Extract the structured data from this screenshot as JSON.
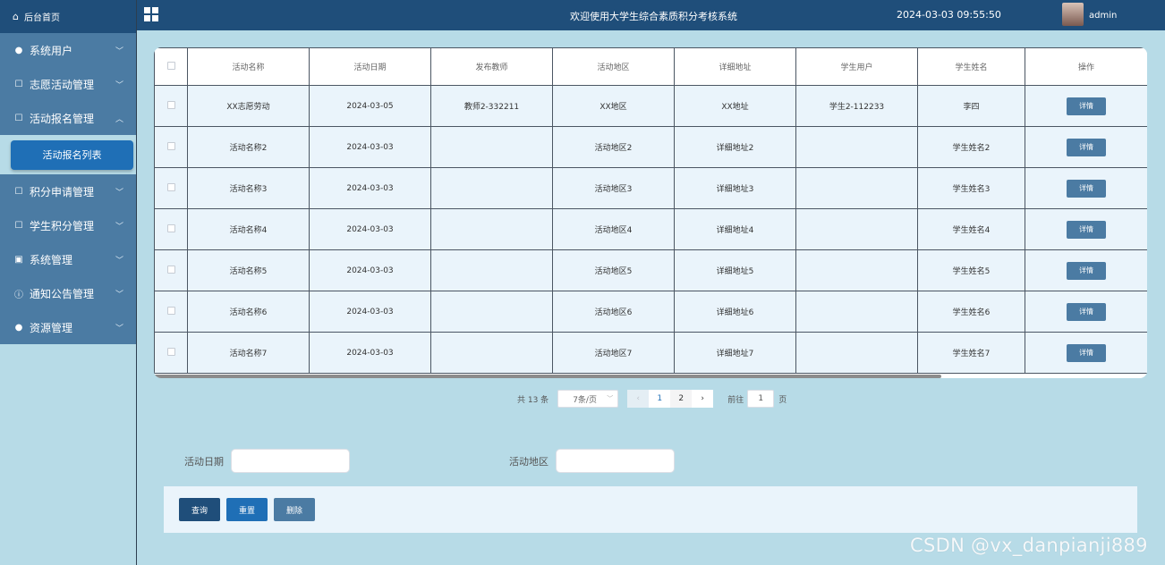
{
  "sidebar": {
    "home_label": "后台首页",
    "items": [
      {
        "label": "系统用户",
        "icon": "user-icon"
      },
      {
        "label": "志愿活动管理",
        "icon": "edit-icon"
      },
      {
        "label": "活动报名管理",
        "icon": "edit-icon"
      },
      {
        "label": "积分申请管理",
        "icon": "edit-icon"
      },
      {
        "label": "学生积分管理",
        "icon": "edit-icon"
      },
      {
        "label": "系统管理",
        "icon": "picture-icon"
      },
      {
        "label": "通知公告管理",
        "icon": "info-icon"
      },
      {
        "label": "资源管理",
        "icon": "location-icon"
      }
    ],
    "sub_item": "活动报名列表"
  },
  "header": {
    "title": "欢迎使用大学生综合素质积分考核系统",
    "datetime": "2024-03-03 09:55:50",
    "username": "admin"
  },
  "table": {
    "columns": [
      "活动名称",
      "活动日期",
      "发布教师",
      "活动地区",
      "详细地址",
      "学生用户",
      "学生姓名",
      "操作"
    ],
    "rows": [
      [
        "XX志愿劳动",
        "2024-03-05",
        "教师2-332211",
        "XX地区",
        "XX地址",
        "学生2-112233",
        "李四"
      ],
      [
        "活动名称2",
        "2024-03-03",
        "",
        "活动地区2",
        "详细地址2",
        "",
        "学生姓名2"
      ],
      [
        "活动名称3",
        "2024-03-03",
        "",
        "活动地区3",
        "详细地址3",
        "",
        "学生姓名3"
      ],
      [
        "活动名称4",
        "2024-03-03",
        "",
        "活动地区4",
        "详细地址4",
        "",
        "学生姓名4"
      ],
      [
        "活动名称5",
        "2024-03-03",
        "",
        "活动地区5",
        "详细地址5",
        "",
        "学生姓名5"
      ],
      [
        "活动名称6",
        "2024-03-03",
        "",
        "活动地区6",
        "详细地址6",
        "",
        "学生姓名6"
      ],
      [
        "活动名称7",
        "2024-03-03",
        "",
        "活动地区7",
        "详细地址7",
        "",
        "学生姓名7"
      ]
    ],
    "detail_label": "详情"
  },
  "pagination": {
    "total": "共 13 条",
    "page_size": "7条/页",
    "pages": [
      "1",
      "2"
    ],
    "goto_label": "前往",
    "goto_value": "1",
    "page_suffix": "页"
  },
  "search": {
    "date_label": "活动日期",
    "area_label": "活动地区",
    "date_value": "",
    "area_value": ""
  },
  "buttons": {
    "query": "查询",
    "reset": "重置",
    "delete": "删除"
  },
  "watermark": "CSDN @vx_danpianji889",
  "colors": {
    "header": "#1f4e7a",
    "sidebar_menu": "#4b7ba3",
    "background": "#b7dbe7",
    "active_submenu": "#1f6fb6",
    "detail_button": "#4b7ba3",
    "query_button": "#1f4e7a",
    "reset_button": "#1f6fb6",
    "delete_button": "#4b7ba3"
  }
}
